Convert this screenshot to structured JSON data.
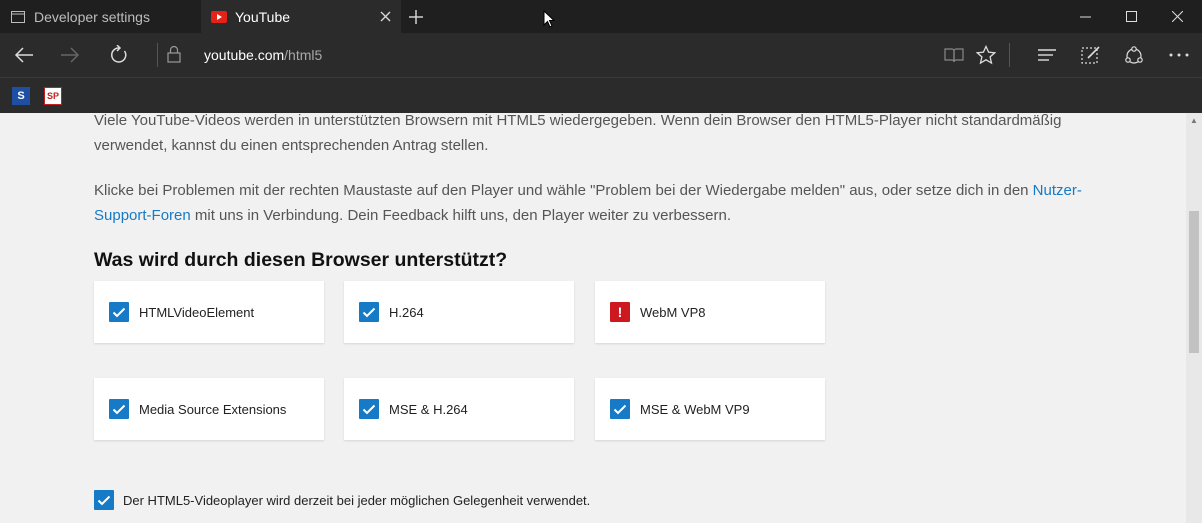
{
  "tabs": [
    {
      "label": "Developer settings",
      "icon": "window-icon",
      "active": false
    },
    {
      "label": "YouTube",
      "icon": "youtube-icon",
      "active": true
    }
  ],
  "address": {
    "domain": "youtube.com",
    "path": "/html5"
  },
  "favorites": [
    {
      "name": "bookmark-1-icon",
      "text": "S"
    },
    {
      "name": "bookmark-2-icon",
      "text": "SP"
    }
  ],
  "page": {
    "paragraph1": "Viele YouTube-Videos werden in unterstützten Browsern mit HTML5 wiedergegeben. Wenn dein Browser den HTML5-Player nicht standardmäßig verwendet, kannst du einen entsprechenden Antrag stellen.",
    "paragraph2_before": "Klicke bei Problemen mit der rechten Maustaste auf den Player und wähle \"Problem bei der Wiedergabe melden\" aus, oder setze dich in den ",
    "paragraph2_link": "Nutzer-Support-Foren",
    "paragraph2_after": " mit uns in Verbindung. Dein Feedback hilft uns, den Player weiter zu verbessern.",
    "heading": "Was wird durch diesen Browser unterstützt?",
    "features": [
      {
        "label": "HTMLVideoElement",
        "status": "supported"
      },
      {
        "label": "H.264",
        "status": "supported"
      },
      {
        "label": "WebM VP8",
        "status": "unsupported"
      },
      {
        "label": "Media Source Extensions",
        "status": "supported"
      },
      {
        "label": "MSE & H.264",
        "status": "supported"
      },
      {
        "label": "MSE & WebM VP9",
        "status": "supported"
      }
    ],
    "footer_note": "Der HTML5-Videoplayer wird derzeit bei jeder möglichen Gelegenheit verwendet."
  },
  "colors": {
    "accent": "#167ac6",
    "error": "#cc181e",
    "chrome_dark": "#1f1f1f",
    "chrome": "#2b2b2b"
  }
}
